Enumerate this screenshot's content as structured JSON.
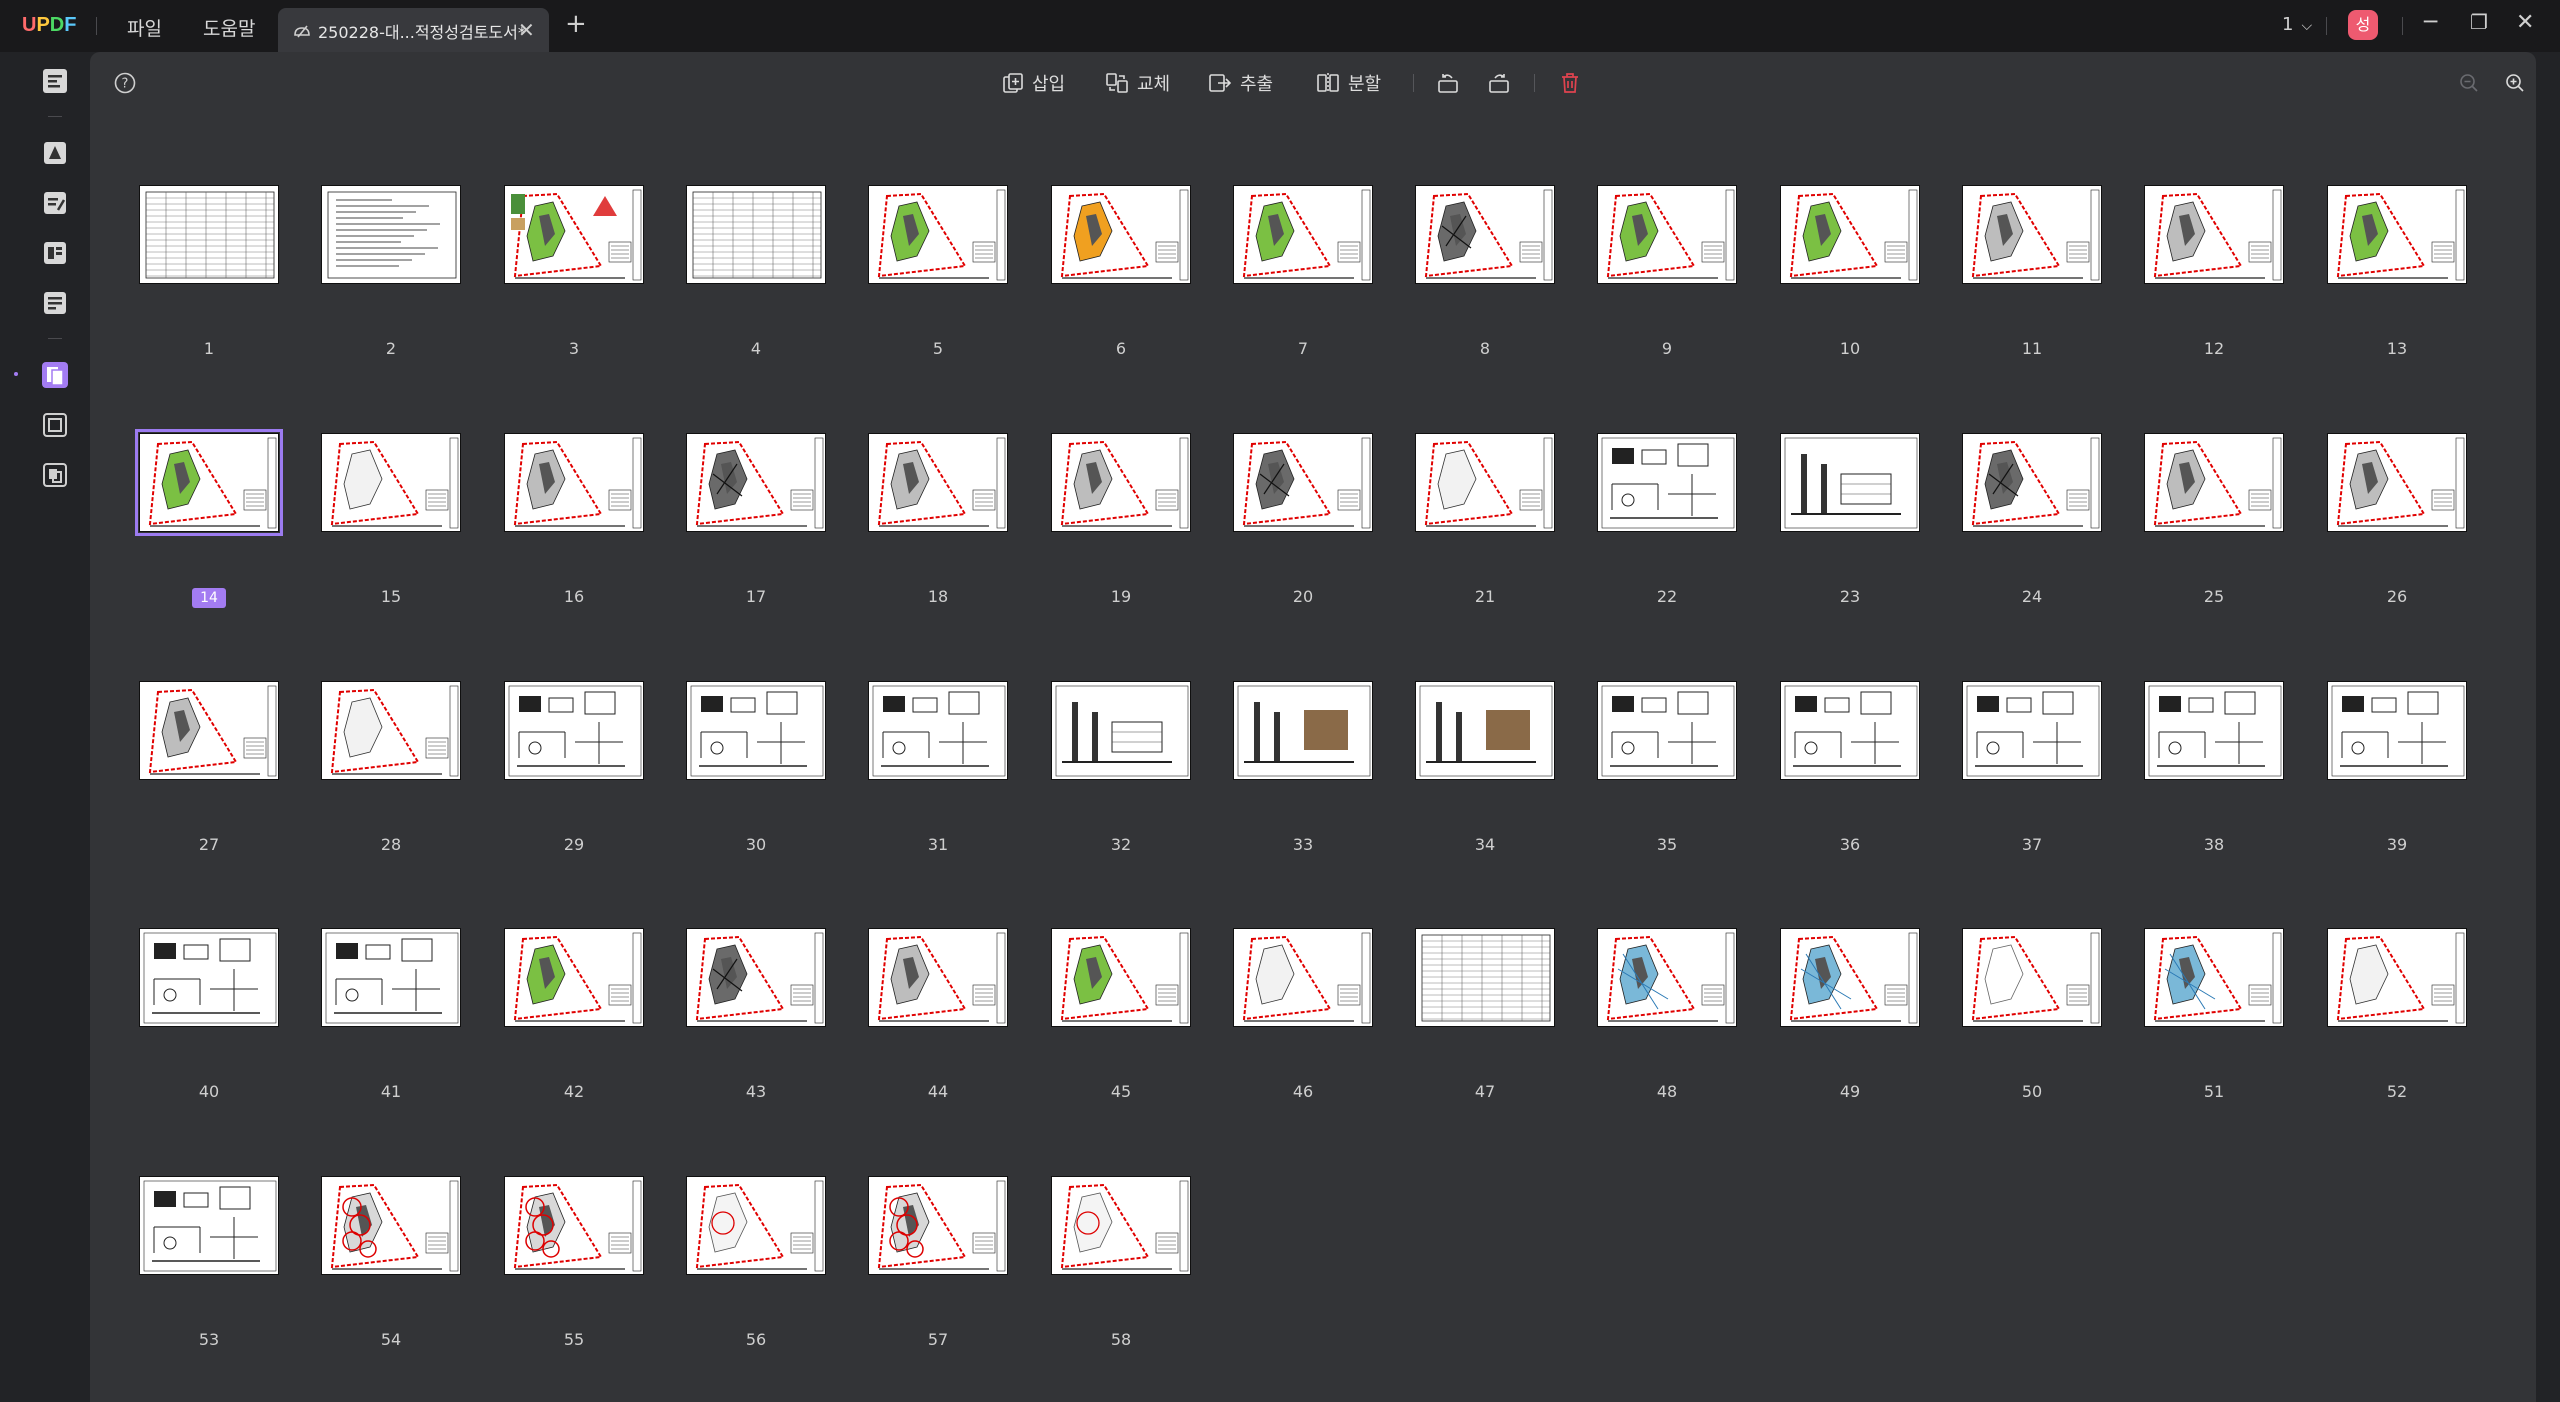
{
  "app": {
    "logo": "UPDF",
    "menu": [
      "파일",
      "도움말"
    ],
    "tab_title": "250228-대...적정성검토도서*",
    "page_indicator": "1",
    "avatar_letter": "성"
  },
  "toolbar": {
    "insert": "삽입",
    "replace": "교체",
    "extract": "추출",
    "split": "분할"
  },
  "pages": {
    "selected": 14,
    "items": [
      {
        "label": "1",
        "kind": "table"
      },
      {
        "label": "2",
        "kind": "doc"
      },
      {
        "label": "3",
        "kind": "plan-color"
      },
      {
        "label": "4",
        "kind": "table"
      },
      {
        "label": "5",
        "kind": "plan-green"
      },
      {
        "label": "6",
        "kind": "plan-orange"
      },
      {
        "label": "7",
        "kind": "plan-green"
      },
      {
        "label": "8",
        "kind": "plan-dark"
      },
      {
        "label": "9",
        "kind": "plan-green"
      },
      {
        "label": "10",
        "kind": "plan-green"
      },
      {
        "label": "11",
        "kind": "plan-gray"
      },
      {
        "label": "12",
        "kind": "plan-gray"
      },
      {
        "label": "13",
        "kind": "plan-green"
      },
      {
        "label": "14",
        "kind": "plan-green"
      },
      {
        "label": "15",
        "kind": "plan-empty"
      },
      {
        "label": "16",
        "kind": "plan-gray"
      },
      {
        "label": "17",
        "kind": "plan-dark"
      },
      {
        "label": "18",
        "kind": "plan-gray"
      },
      {
        "label": "19",
        "kind": "plan-gray"
      },
      {
        "label": "20",
        "kind": "plan-dark"
      },
      {
        "label": "21",
        "kind": "plan-empty"
      },
      {
        "label": "22",
        "kind": "details"
      },
      {
        "label": "23",
        "kind": "section"
      },
      {
        "label": "24",
        "kind": "plan-dark"
      },
      {
        "label": "25",
        "kind": "plan-gray"
      },
      {
        "label": "26",
        "kind": "plan-gray"
      },
      {
        "label": "27",
        "kind": "plan-gray"
      },
      {
        "label": "28",
        "kind": "plan-empty"
      },
      {
        "label": "29",
        "kind": "details"
      },
      {
        "label": "30",
        "kind": "details"
      },
      {
        "label": "31",
        "kind": "details"
      },
      {
        "label": "32",
        "kind": "section"
      },
      {
        "label": "33",
        "kind": "section-brown"
      },
      {
        "label": "34",
        "kind": "section-brown"
      },
      {
        "label": "35",
        "kind": "details"
      },
      {
        "label": "36",
        "kind": "details"
      },
      {
        "label": "37",
        "kind": "details"
      },
      {
        "label": "38",
        "kind": "details"
      },
      {
        "label": "39",
        "kind": "details"
      },
      {
        "label": "40",
        "kind": "details"
      },
      {
        "label": "41",
        "kind": "details"
      },
      {
        "label": "42",
        "kind": "plan-green"
      },
      {
        "label": "43",
        "kind": "plan-dark"
      },
      {
        "label": "44",
        "kind": "plan-gray"
      },
      {
        "label": "45",
        "kind": "plan-green"
      },
      {
        "label": "46",
        "kind": "plan-empty"
      },
      {
        "label": "47",
        "kind": "table"
      },
      {
        "label": "48",
        "kind": "plan-blue"
      },
      {
        "label": "49",
        "kind": "plan-blue"
      },
      {
        "label": "50",
        "kind": "plan-outline"
      },
      {
        "label": "51",
        "kind": "plan-blue"
      },
      {
        "label": "52",
        "kind": "plan-empty"
      },
      {
        "label": "53",
        "kind": "details"
      },
      {
        "label": "54",
        "kind": "plan-circles"
      },
      {
        "label": "55",
        "kind": "plan-circles"
      },
      {
        "label": "56",
        "kind": "plan-circles-light"
      },
      {
        "label": "57",
        "kind": "plan-circles"
      },
      {
        "label": "58",
        "kind": "plan-circles-light"
      }
    ]
  },
  "colors": {
    "accent": "#a37cf2",
    "logo_u": "#ff6b6b",
    "logo_p": "#ffc83d",
    "logo_d": "#4cd964",
    "logo_f": "#5ac8fa",
    "delete": "#e0434f",
    "avatar": "#ee5a70"
  }
}
